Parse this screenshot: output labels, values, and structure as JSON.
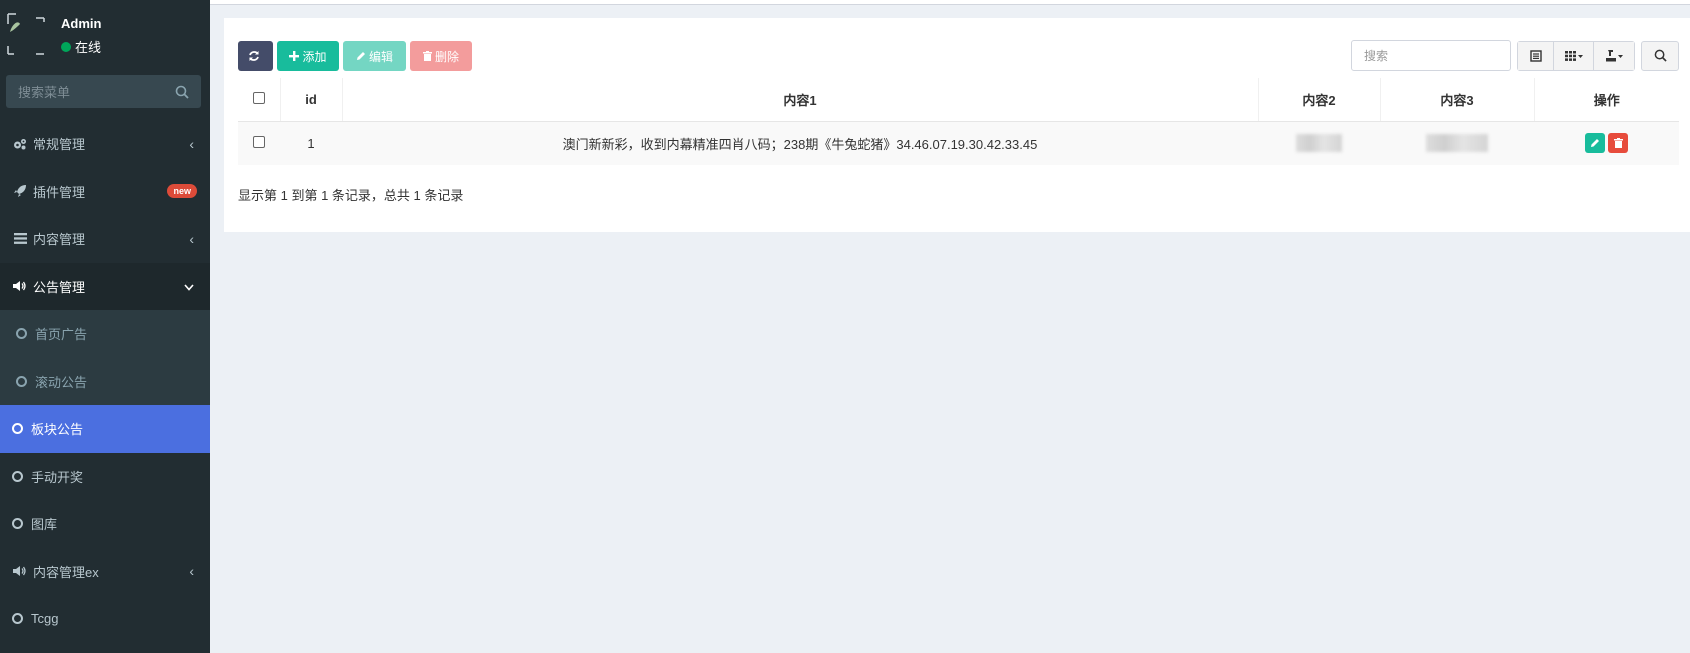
{
  "user": {
    "name": "Admin",
    "status": "在线"
  },
  "sidebar": {
    "search_placeholder": "搜索菜单",
    "items": [
      {
        "label": "常规管理",
        "icon": "gears-icon",
        "arrow": "‹"
      },
      {
        "label": "插件管理",
        "icon": "rocket-icon",
        "badge": "new"
      },
      {
        "label": "内容管理",
        "icon": "list-icon",
        "arrow": "‹"
      },
      {
        "label": "公告管理",
        "icon": "volume-icon",
        "arrow": "⌄"
      },
      {
        "label": "首页广告"
      },
      {
        "label": "滚动公告"
      },
      {
        "label": "板块公告"
      },
      {
        "label": "手动开奖"
      },
      {
        "label": "图库"
      },
      {
        "label": "内容管理ex",
        "icon": "volume-icon",
        "arrow": "‹"
      },
      {
        "label": "Tcgg"
      }
    ]
  },
  "toolbar": {
    "add_label": "添加",
    "edit_label": "编辑",
    "delete_label": "删除",
    "search_placeholder": "搜索"
  },
  "table": {
    "headers": [
      "id",
      "内容1",
      "内容2",
      "内容3",
      "操作"
    ],
    "rows": [
      {
        "id": "1",
        "content1": "澳门新新彩，收到内幕精准四肖八码；238期《牛兔蛇猪》34.46.07.19.30.42.33.45"
      }
    ]
  },
  "pagination": {
    "info": "显示第 1 到第 1 条记录，总共 1 条记录"
  },
  "colors": {
    "sidebar_bg": "#222d32",
    "active": "#4b6fe0",
    "add": "#18bc9c",
    "delete": "#e74c3c",
    "refresh": "#444c69"
  }
}
